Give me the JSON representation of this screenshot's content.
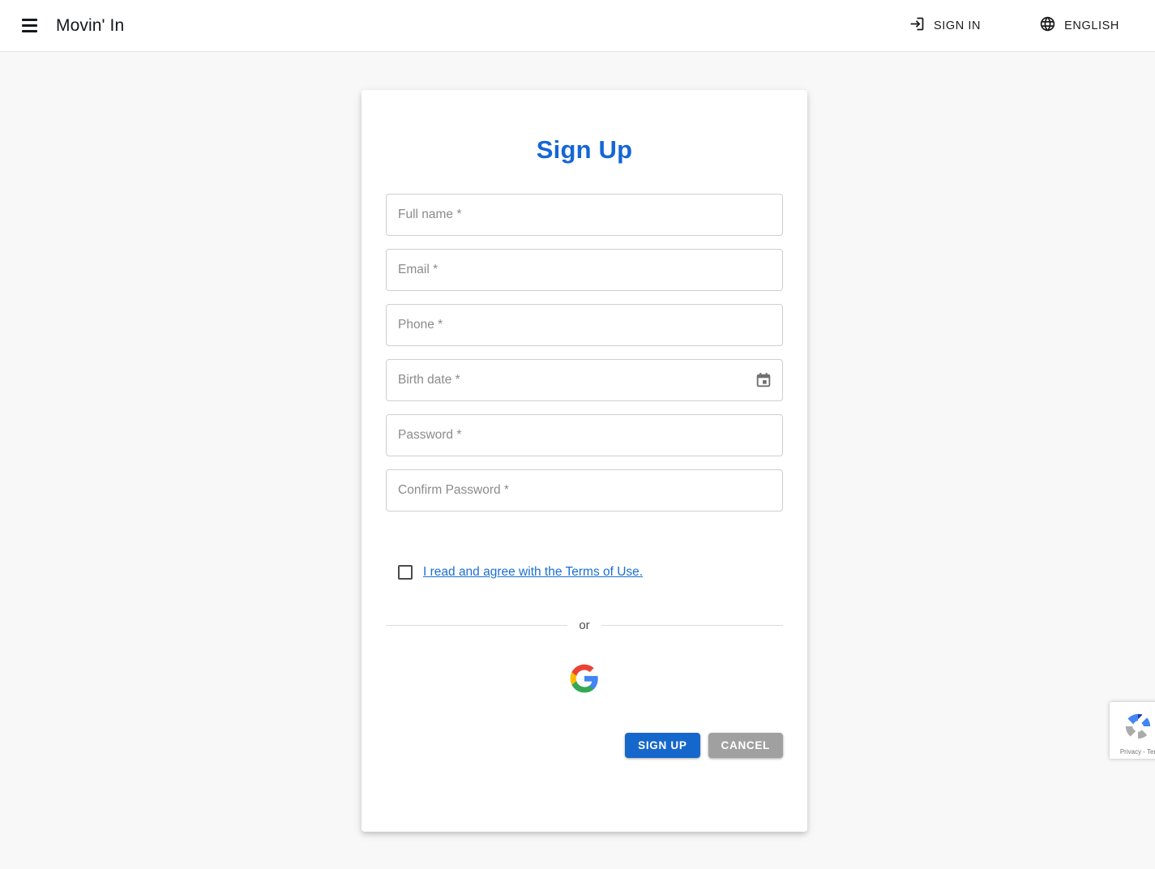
{
  "header": {
    "menu_icon": "hamburger-menu-icon",
    "brand": "Movin' In",
    "sign_in": {
      "label": "SIGN IN",
      "icon": "login-icon"
    },
    "language": {
      "label": "ENGLISH",
      "icon": "globe-icon"
    }
  },
  "card": {
    "title": "Sign Up",
    "fields": [
      {
        "name": "full-name",
        "placeholder": "Full name *",
        "value": "",
        "type": "text",
        "icon": null
      },
      {
        "name": "email",
        "placeholder": "Email *",
        "value": "",
        "type": "text",
        "icon": null
      },
      {
        "name": "phone",
        "placeholder": "Phone *",
        "value": "",
        "type": "text",
        "icon": null
      },
      {
        "name": "birth-date",
        "placeholder": "Birth date *",
        "value": "",
        "type": "text",
        "icon": "calendar-icon"
      },
      {
        "name": "password",
        "placeholder": "Password *",
        "value": "",
        "type": "password",
        "icon": null
      },
      {
        "name": "confirm-password",
        "placeholder": "Confirm Password *",
        "value": "",
        "type": "password",
        "icon": null
      }
    ],
    "terms": {
      "checked": false,
      "link_text": "I read and agree with the Terms of Use."
    },
    "divider_text": "or",
    "google_icon": "google-g-icon",
    "buttons": {
      "submit": "SIGN UP",
      "cancel": "CANCEL"
    }
  },
  "recaptcha": {
    "icon": "recaptcha-icon",
    "text": "Privacy - Ter"
  },
  "colors": {
    "accent_blue": "#1566d6",
    "button_blue": "#1667cb",
    "cancel_gray": "#a0a0a0",
    "link_blue": "#1b6fd0",
    "page_background": "#f8f8f8",
    "card_background": "#ffffff"
  }
}
